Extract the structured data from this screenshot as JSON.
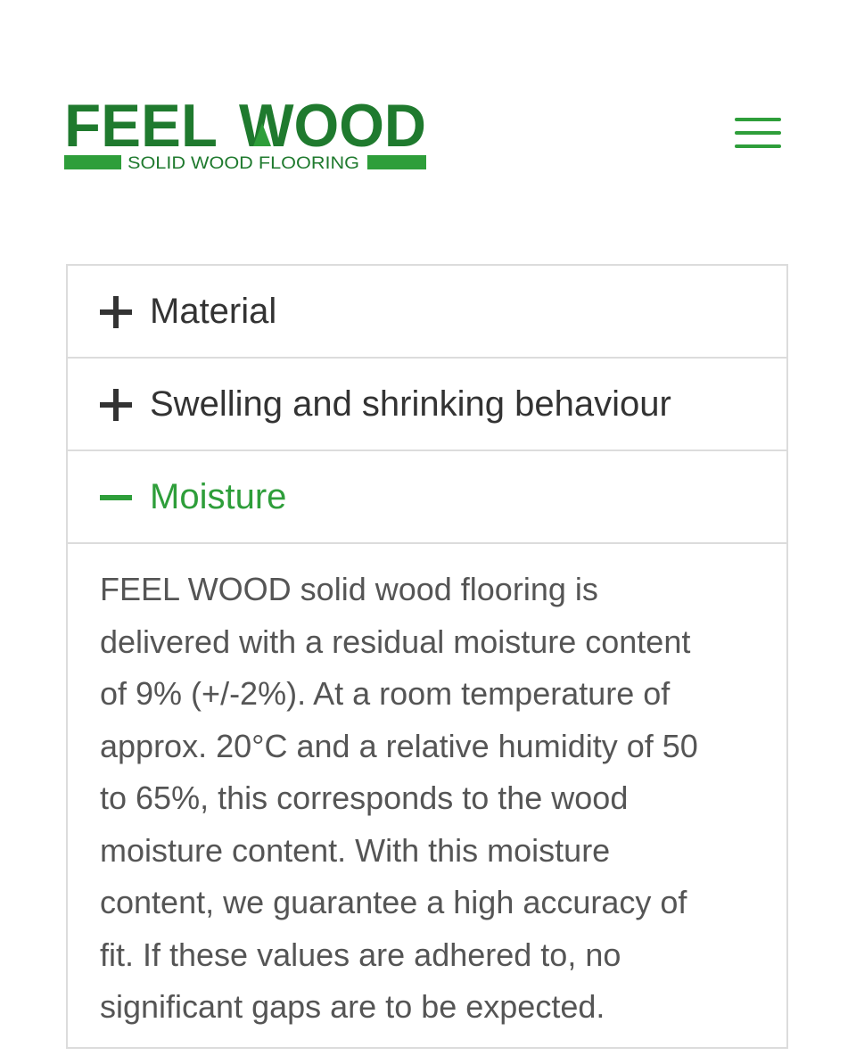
{
  "header": {
    "logo": {
      "brand_left": "FEEL",
      "brand_right": "WOOD",
      "tagline": "SOLID WOOD FLOORING",
      "brand_color": "#1f7a2e",
      "accent_color": "#2e9e3a"
    },
    "menu_icon": "hamburger-menu-icon"
  },
  "accordion": {
    "items": [
      {
        "label": "Material",
        "state": "collapsed",
        "icon": "plus-icon"
      },
      {
        "label": "Swelling and shrinking behaviour",
        "state": "collapsed",
        "icon": "plus-icon"
      },
      {
        "label": "Moisture",
        "state": "expanded",
        "icon": "minus-icon"
      }
    ],
    "open_content": {
      "lines": [
        "FEEL WOOD solid wood flooring is",
        "delivered with a residual moisture content",
        "of 9% (+/-2%). At a room temperature of",
        "approx. 20°C and a relative humidity of 50",
        "to 65%, this corresponds to the wood",
        "moisture content. With this moisture",
        "content, we guarantee a high accuracy of",
        "fit. If these values are adhered to, no",
        "significant gaps are to be expected."
      ]
    }
  },
  "colors": {
    "accent_green": "#2e9e3a",
    "text_dark": "#333333",
    "text_body": "#555555",
    "border": "#dcdcdc"
  }
}
